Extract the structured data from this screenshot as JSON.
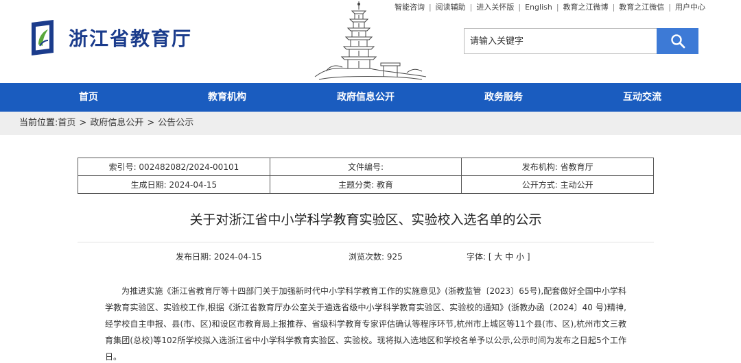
{
  "site": {
    "name": "浙江省教育厅",
    "search_placeholder": "请输入关键字"
  },
  "top_links": [
    "智能咨询",
    "阅读辅助",
    "进入关怀版",
    "English",
    "教育之江微博",
    "教育之江微信",
    "用户中心"
  ],
  "nav": [
    "首页",
    "教育机构",
    "政府信息公开",
    "政务服务",
    "互动交流"
  ],
  "breadcrumb": {
    "label": "当前位置:",
    "items": [
      "首页",
      "政府信息公开",
      "公告公示"
    ]
  },
  "meta": {
    "index_no": "索引号: 002482082/2024-00101",
    "doc_no": "文件编号:",
    "publisher": "发布机构: 省教育厅",
    "created": "生成日期: 2024-04-15",
    "category": "主题分类: 教育",
    "disclosure": "公开方式: 主动公开"
  },
  "article": {
    "title": "关于对浙江省中小学科学教育实验区、实验校入选名单的公示",
    "publish_date": "发布日期: 2024-04-15",
    "views": "浏览次数: 925",
    "font_label": "字体:",
    "font_open": "[",
    "font_large": "大",
    "font_medium": "中",
    "font_small": "小",
    "font_close": "]",
    "paragraph": "为推进实施《浙江省教育厅等十四部门关于加强新时代中小学科学教育工作的实施意见》(浙教监管〔2023〕65号),配套做好全国中小学科学教育实验区、实验校工作,根据《浙江省教育厅办公室关于遴选省级中小学科学教育实验区、实验校的通知》(浙教办函〔2024〕40 号)精神,经学校自主申报、县(市、区)和设区市教育局上报推荐、省级科学教育专家评估确认等程序环节,杭州市上城区等11个县(市、区),杭州市文三教育集团(总校)等102所学校拟入选浙江省中小学科学教育实验区、实验校。现将拟入选地区和学校名单予以公示,公示时间为发布之日起5个工作日。"
  },
  "colors": {
    "nav_bg": "#1a5cbf",
    "search_button": "#3d7ad6",
    "logo_blue": "#1b3c8c",
    "breadcrumb_bg": "#eeeeee"
  },
  "icons": {
    "logo": "zhejiang-education-logo-icon",
    "search": "search-icon",
    "banner": "pagoda-illustration"
  }
}
